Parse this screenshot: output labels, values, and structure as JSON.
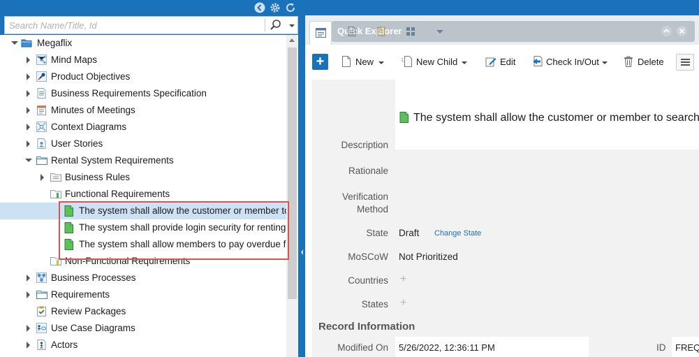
{
  "search": {
    "placeholder": "Search Name/Title, Id"
  },
  "tree": {
    "root": "Megaflix",
    "items": [
      "Mind Maps",
      "Product Objectives",
      "Business Requirements Specification",
      "Minutes of Meetings",
      "Context Diagrams",
      "User Stories",
      "Rental System Requirements",
      "Business Rules",
      "Functional Requirements",
      "The system shall allow the customer or member to",
      "The system shall provide login security for renting vi",
      "The system shall allow members to pay overdue fine",
      "Non-Functional Requirements",
      "Business Processes",
      "Requirements",
      "Review Packages",
      "Use Case Diagrams",
      "Actors"
    ]
  },
  "quick_explorer": {
    "title": "Quick Explorer"
  },
  "toolbar": {
    "new": "New",
    "new_child": "New Child",
    "edit": "Edit",
    "check_in_out": "Check In/Out",
    "delete": "Delete"
  },
  "record": {
    "title": "The system shall allow the customer or member to search",
    "labels": {
      "description": "Description",
      "rationale": "Rationale",
      "verification_1": "Verification",
      "verification_2": "Method",
      "state": "State",
      "moscow": "MoSCoW",
      "countries": "Countries",
      "states": "States",
      "modified_on": "Modified On",
      "id": "ID"
    },
    "values": {
      "state": "Draft",
      "change_state": "Change State",
      "moscow": "Not Prioritized",
      "modified_on": "5/26/2022, 12:36:11 PM",
      "id": "FREQ"
    },
    "section": "Record Information"
  },
  "colors": {
    "brand": "#1a72bb",
    "selected": "#cde1f5",
    "highlight": "#d9534f"
  }
}
